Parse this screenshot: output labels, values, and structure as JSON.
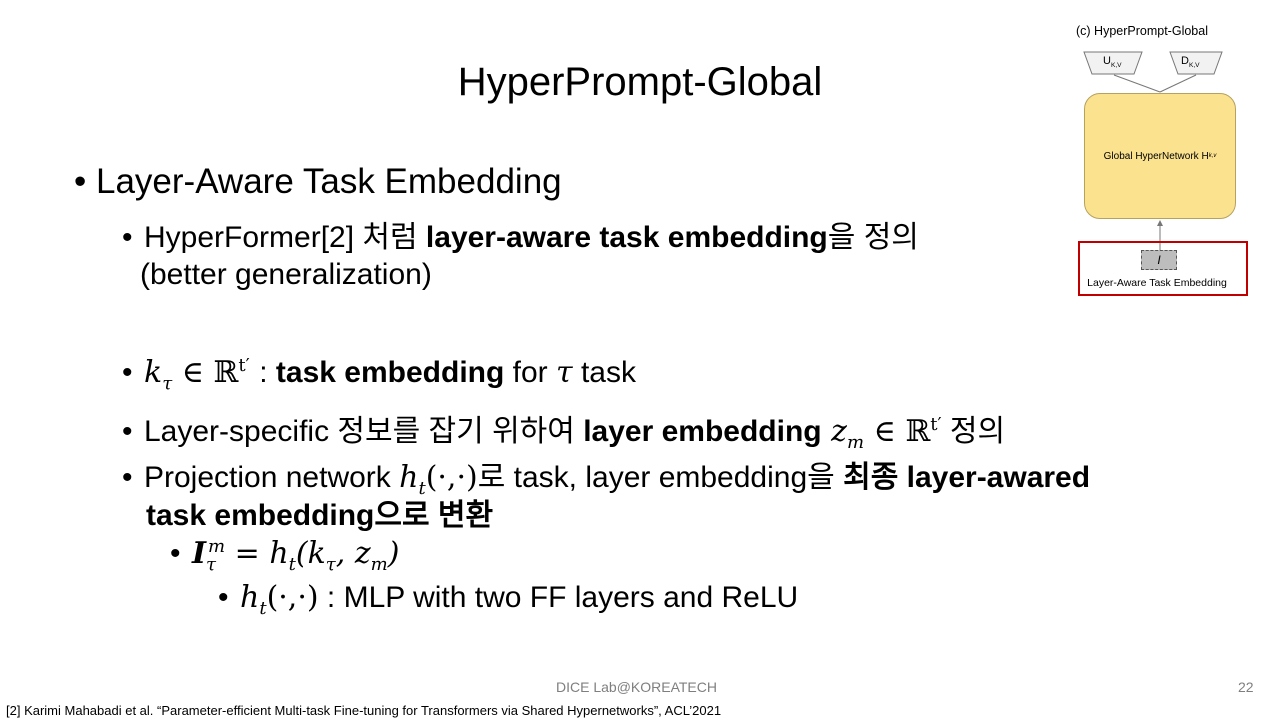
{
  "title": "HyperPrompt-Global",
  "bullets": {
    "l1": "Layer-Aware Task Embedding",
    "b1_prefix": "HyperFormer[2] 처럼 ",
    "b1_bold": "layer-aware task embedding",
    "b1_suffix": "을 정의",
    "b1_line2": "(better generalization)",
    "b2_bold": "task embedding",
    "b2_suffix": " for ",
    "b2_tail": " task",
    "b3_prefix": "Layer-specific 정보를 잡기 위하여 ",
    "b3_bold": "layer embedding",
    "b3_suffix": " 정의",
    "b4_prefix": "Projection network ",
    "b4_mid": "로 task, layer embedding을 ",
    "b4_bold1": "최종 layer-awared",
    "b4_bold2": "task embedding으로 변환",
    "b6_suffix": " : MLP with two FF layers and ReLU"
  },
  "diagram": {
    "title": "(c) HyperPrompt-Global",
    "u_label": "U",
    "u_sub": "K,V",
    "d_label": "D",
    "d_sub": "K,V",
    "hypernetwork_label": "Global HyperNetwork H",
    "hypernetwork_sub": "k,v",
    "I_label": "I",
    "embedding_label": "Layer-Aware Task Embedding"
  },
  "footer": "DICE Lab@KOREATECH",
  "page_number": "22",
  "reference": "[2] Karimi Mahabadi et al. “Parameter-efficient Multi-task Fine-tuning for Transformers via Shared Hypernetworks”, ACL’2021",
  "colors": {
    "hypernetwork_fill": "#fbe28f",
    "highlight_border": "#c00000",
    "footer_text": "#7f7f7f"
  }
}
